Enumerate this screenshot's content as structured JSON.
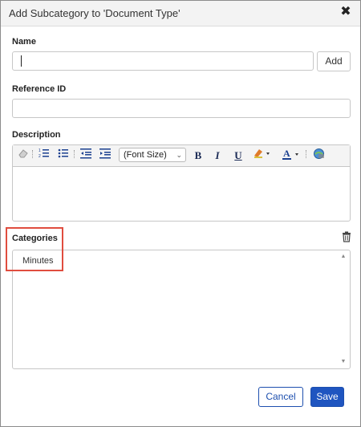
{
  "dialog": {
    "title": "Add Subcategory to 'Document Type'",
    "close_glyph": "✖"
  },
  "name": {
    "label": "Name",
    "value": "",
    "add_label": "Add"
  },
  "reference": {
    "label": "Reference ID",
    "value": ""
  },
  "description": {
    "label": "Description",
    "toolbar": {
      "font_size": "(Font Size)",
      "bold": "B",
      "italic": "I",
      "underline": "U",
      "font_color": "A"
    },
    "value": ""
  },
  "categories": {
    "label": "Categories",
    "items": [
      "Minutes"
    ]
  },
  "footer": {
    "cancel_label": "Cancel",
    "save_label": "Save"
  },
  "colors": {
    "primary": "#1f55c0",
    "highlight": "#e04d3f"
  },
  "icons": [
    "close-icon",
    "eraser-icon",
    "ordered-list-icon",
    "unordered-list-icon",
    "outdent-icon",
    "indent-icon",
    "highlight-icon",
    "font-color-icon",
    "link-icon",
    "trash-icon"
  ]
}
